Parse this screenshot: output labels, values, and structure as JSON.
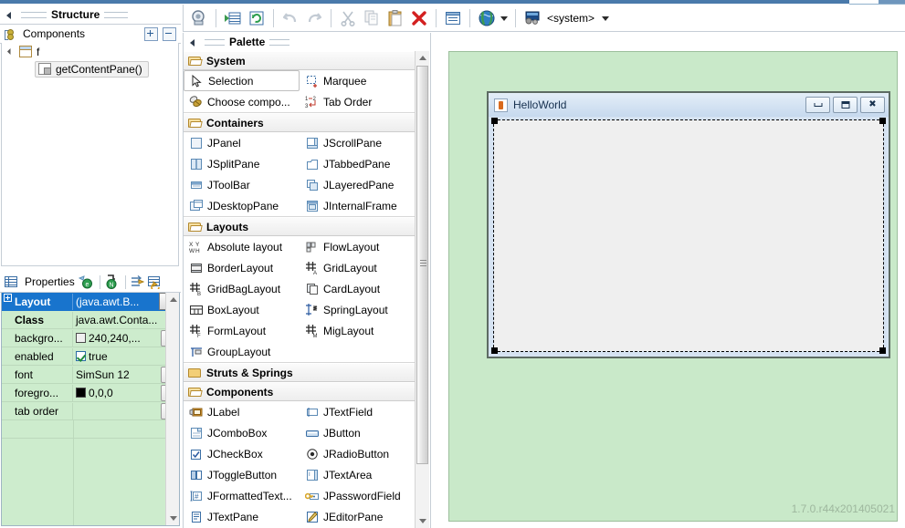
{
  "structure": {
    "title": "Structure",
    "header_label": "Components",
    "expand_all_label": "+",
    "collapse_all_label": "-",
    "tree": [
      {
        "label": "f",
        "icon": "frame-icon",
        "indent": 0
      },
      {
        "label": "getContentPane()",
        "icon": "content-pane-icon",
        "indent": 1
      }
    ]
  },
  "properties": {
    "title": "Properties",
    "rows": [
      {
        "name": "Layout",
        "value": "(java.awt.B...",
        "selected": true,
        "control": "combo",
        "bold": true,
        "expandable": true
      },
      {
        "name": "Class",
        "value": "java.awt.Conta...",
        "selected": false,
        "control": "none",
        "bold": true
      },
      {
        "name": "backgro...",
        "value": "240,240,...",
        "selected": false,
        "control": "ellipsis",
        "swatch": "#f0f0f0"
      },
      {
        "name": "enabled",
        "value": "true",
        "selected": false,
        "control": "checkbox"
      },
      {
        "name": "font",
        "value": "SimSun 12",
        "selected": false,
        "control": "ellipsis"
      },
      {
        "name": "foregro...",
        "value": "0,0,0",
        "selected": false,
        "control": "ellipsis",
        "swatch": "#000000"
      },
      {
        "name": "tab order",
        "value": "",
        "selected": false,
        "control": "ellipsis"
      }
    ]
  },
  "palette": {
    "title": "Palette",
    "categories": [
      {
        "label": "System",
        "folder": "folder-open-icon",
        "items": [
          {
            "label": "Selection",
            "icon": "cursor-icon",
            "selected": true
          },
          {
            "label": "Marquee",
            "icon": "marquee-icon",
            "selected": false
          },
          {
            "label": "Choose compo...",
            "icon": "choose-component-icon",
            "selected": false
          },
          {
            "label": "Tab Order",
            "icon": "tab-order-icon",
            "selected": false
          }
        ]
      },
      {
        "label": "Containers",
        "folder": "folder-open-icon",
        "items": [
          {
            "label": "JPanel",
            "icon": "jpanel-icon",
            "selected": false
          },
          {
            "label": "JScrollPane",
            "icon": "jscrollpane-icon",
            "selected": false
          },
          {
            "label": "JSplitPane",
            "icon": "jsplitpane-icon",
            "selected": false
          },
          {
            "label": "JTabbedPane",
            "icon": "jtabbedpane-icon",
            "selected": false
          },
          {
            "label": "JToolBar",
            "icon": "jtoolbar-icon",
            "selected": false
          },
          {
            "label": "JLayeredPane",
            "icon": "jlayeredpane-icon",
            "selected": false
          },
          {
            "label": "JDesktopPane",
            "icon": "jdesktoppane-icon",
            "selected": false
          },
          {
            "label": "JInternalFrame",
            "icon": "jinternalframe-icon",
            "selected": false
          }
        ]
      },
      {
        "label": "Layouts",
        "folder": "folder-open-icon",
        "items": [
          {
            "label": "Absolute layout",
            "icon": "absolute-layout-icon",
            "selected": false
          },
          {
            "label": "FlowLayout",
            "icon": "flowlayout-icon",
            "selected": false
          },
          {
            "label": "BorderLayout",
            "icon": "borderlayout-icon",
            "selected": false
          },
          {
            "label": "GridLayout",
            "icon": "gridlayout-icon",
            "selected": false
          },
          {
            "label": "GridBagLayout",
            "icon": "gridbaglayout-icon",
            "selected": false
          },
          {
            "label": "CardLayout",
            "icon": "cardlayout-icon",
            "selected": false
          },
          {
            "label": "BoxLayout",
            "icon": "boxlayout-icon",
            "selected": false
          },
          {
            "label": "SpringLayout",
            "icon": "springlayout-icon",
            "selected": false
          },
          {
            "label": "FormLayout",
            "icon": "formlayout-icon",
            "selected": false
          },
          {
            "label": "MigLayout",
            "icon": "miglayout-icon",
            "selected": false
          },
          {
            "label": "GroupLayout",
            "icon": "grouplayout-icon",
            "selected": false
          }
        ]
      },
      {
        "label": "Struts & Springs",
        "folder": "folder-closed-icon",
        "items": []
      },
      {
        "label": "Components",
        "folder": "folder-open-icon",
        "items": [
          {
            "label": "JLabel",
            "icon": "jlabel-icon",
            "selected": false
          },
          {
            "label": "JTextField",
            "icon": "jtextfield-icon",
            "selected": false
          },
          {
            "label": "JComboBox",
            "icon": "jcombobox-icon",
            "selected": false
          },
          {
            "label": "JButton",
            "icon": "jbutton-icon",
            "selected": false
          },
          {
            "label": "JCheckBox",
            "icon": "jcheckbox-icon",
            "selected": false
          },
          {
            "label": "JRadioButton",
            "icon": "jradiobutton-icon",
            "selected": false
          },
          {
            "label": "JToggleButton",
            "icon": "jtogglebutton-icon",
            "selected": false
          },
          {
            "label": "JTextArea",
            "icon": "jtextarea-icon",
            "selected": false
          },
          {
            "label": "JFormattedText...",
            "icon": "jformattedtextfield-icon",
            "selected": false
          },
          {
            "label": "JPasswordField",
            "icon": "jpasswordfield-icon",
            "selected": false
          },
          {
            "label": "JTextPane",
            "icon": "jtextpane-icon",
            "selected": false
          },
          {
            "label": "JEditorPane",
            "icon": "jeditorpane-icon",
            "selected": false
          }
        ]
      }
    ]
  },
  "toolbar": {
    "buttons": [
      {
        "name": "open-source-button",
        "icon": "source-icon"
      },
      {
        "name": "test-button",
        "icon": "test-icon"
      },
      {
        "name": "refresh-button",
        "icon": "refresh-icon"
      },
      {
        "name": "undo-button",
        "icon": "undo-icon"
      },
      {
        "name": "redo-button",
        "icon": "redo-icon"
      },
      {
        "name": "cut-button",
        "icon": "scissors-icon"
      },
      {
        "name": "copy-button",
        "icon": "copy-icon"
      },
      {
        "name": "paste-button",
        "icon": "paste-icon"
      },
      {
        "name": "delete-button",
        "icon": "delete-x-icon"
      },
      {
        "name": "properties-button",
        "icon": "properties-icon"
      },
      {
        "name": "locale-button",
        "icon": "globe-icon"
      },
      {
        "name": "look-and-feel-button",
        "icon": "laf-icon"
      }
    ],
    "laf_label": "<system>"
  },
  "design": {
    "window_title": "HelloWorld",
    "window_icon": "java-cup-icon",
    "minimize_label": "",
    "maximize_label": "",
    "close_label": "✖",
    "watermark": "1.7.0.r44x201405021"
  },
  "colors": {
    "selection_blue": "#1874cd",
    "canvas_green": "#c9e9c9",
    "property_green": "#cdeccd",
    "title_blue": "#4a7aab"
  }
}
